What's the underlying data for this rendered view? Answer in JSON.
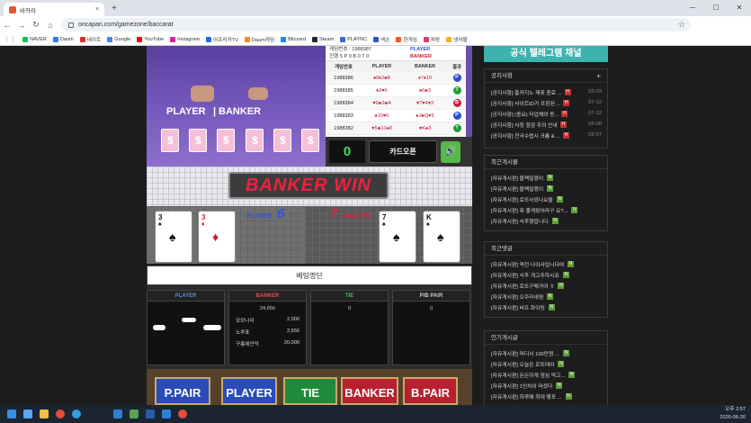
{
  "browser": {
    "tab_title": "바카라",
    "tab_close": "×",
    "new_tab": "+",
    "url": "oncapan.com/gamezone/baccarat",
    "win_min": "─",
    "win_max": "☐",
    "win_close": "✕"
  },
  "bookmarks": [
    {
      "label": "NAVER",
      "color": "#03c75a"
    },
    {
      "label": "Daum",
      "color": "#2b7de9"
    },
    {
      "label": "네이트",
      "color": "#e0302c"
    },
    {
      "label": "Google",
      "color": "#4285f4"
    },
    {
      "label": "YouTube",
      "color": "#ff0000"
    },
    {
      "label": "Instagram",
      "color": "#d6249f"
    },
    {
      "label": "아프리카TV",
      "color": "#1c6fe8"
    },
    {
      "label": "Daum게임",
      "color": "#f58a1f"
    },
    {
      "label": "Blizzard",
      "color": "#148eff"
    },
    {
      "label": "Steam",
      "color": "#1b2838"
    },
    {
      "label": "PLAYNC",
      "color": "#3a6ad1"
    },
    {
      "label": "넥슨",
      "color": "#2f59c4"
    },
    {
      "label": "한게임",
      "color": "#f25a29"
    },
    {
      "label": "피망",
      "color": "#e03a6c"
    },
    {
      "label": "넷마블",
      "color": "#f2b21a"
    }
  ],
  "game": {
    "felt_player": "PLAYER",
    "felt_banker": "BANKER",
    "history": {
      "round_label": "게임번호 : 1988387",
      "count_label": "진행 5  P 0  B 0  T 0",
      "player_head": "PLAYER",
      "banker_head": "BANKER",
      "columns": [
        "게임번호",
        "PLAYER",
        "BANKER",
        "결과"
      ],
      "rows": [
        {
          "no": "1988386",
          "p": "♠9♦2♣8",
          "b": "♦7♦10",
          "r": "P",
          "rc": "#2a4bd0"
        },
        {
          "no": "1988385",
          "p": "♠3♥6",
          "b": "♠6♣3",
          "r": "T",
          "rc": "#1f9c3a"
        },
        {
          "no": "1988384",
          "p": "♥9♣3♣A",
          "b": "♥7♥4♥3",
          "r": "B",
          "rc": "#d0203a"
        },
        {
          "no": "1988383",
          "p": "♠10♥6",
          "b": "♠J♣Q♥5",
          "r": "P",
          "rc": "#2a4bd0"
        },
        {
          "no": "1988382",
          "p": "♥5♣10♠8",
          "b": "♥K♠3",
          "r": "T",
          "rc": "#1f9c3a"
        }
      ]
    },
    "counter": "0",
    "card_open": "카드오픈",
    "sound_icon": "🔊",
    "result_text": "BANKER WIN",
    "player_side": {
      "label": "PLAYER",
      "score": "6"
    },
    "banker_side": {
      "label": "BANKER",
      "score": "7"
    },
    "cards": [
      {
        "rank": "3",
        "suit": "♠",
        "color": "#111"
      },
      {
        "rank": "3",
        "suit": "♦",
        "color": "#d0203a"
      },
      {
        "rank": "7",
        "suit": "♠",
        "color": "#111"
      },
      {
        "rank": "K",
        "suit": "♠",
        "color": "#111"
      }
    ]
  },
  "betting": {
    "title": "베팅명단",
    "cols": [
      {
        "label": "PLAYER",
        "color": "#4a8fe0"
      },
      {
        "label": "BANKER",
        "color": "#e05050"
      },
      {
        "label": "TIE",
        "color": "#3ec05a"
      },
      {
        "label": "P/B PAIR",
        "color": "#ccc"
      }
    ],
    "banker_total": "24,656",
    "tie_total": "0",
    "pair_total": "0",
    "banker_rows": [
      {
        "name": "모모나미",
        "amount": "2,000"
      },
      {
        "name": "노루표",
        "amount": "2,656"
      },
      {
        "name": "구름에언덕",
        "amount": "20,000"
      }
    ]
  },
  "chips": [
    {
      "label": "P.PAIR",
      "color": "#2a4bb8"
    },
    {
      "label": "PLAYER",
      "color": "#2a4bb8"
    },
    {
      "label": "TIE",
      "color": "#1f8a3a"
    },
    {
      "label": "BANKER",
      "color": "#b82030"
    },
    {
      "label": "B.PAIR",
      "color": "#b82030"
    }
  ],
  "sidebar": {
    "telegram": "공식 텔레그램 채널",
    "notice_head": "공지사항",
    "notice_plus": "+",
    "notices": [
      {
        "t": "[공지사항] 홈카지노 제휴 종료 ...",
        "d": "03-03"
      },
      {
        "t": "[공지사항] 사이트ID가 포함된 ...",
        "d": "07-12"
      },
      {
        "t": "[공지사항] (중요) 타업체와 동...",
        "d": "07-12"
      },
      {
        "t": "[공지사항] 사칭 점검 주의 안내",
        "d": "05-08"
      },
      {
        "t": "[공지사항] 전국수렵시 크롬 & ...",
        "d": "02-07"
      }
    ],
    "recent_head": "최근게시물",
    "recent": [
      "[자유게시판] 블랙밀했이",
      "[자유게시판] 블랙밀했이",
      "[자유게시판] 로또사셨나요들",
      "[자유게시판] 뭐 좋게왔어라구 요?...",
      "[자유게시판] 식후했읍니다"
    ],
    "comments_head": "최근댓글",
    "comments": [
      "[자유게시판] 역전 나이사입니다여",
      "[자유게시판] 식후 개고주하시죠",
      "[자유게시판] 로또구매가여 ㅎ",
      "[자유게시판] 오주라내염",
      "[자유게시판] 버프 화이팅"
    ],
    "popular_head": "인기게시글",
    "popular": [
      "[자유게시판] 머디서 100만원 ...",
      "[자유게시판] 오늘은 로또데이",
      "[자유게시판] 돈든하게 점심 먹고...",
      "[자유게시판] 1인치이 마셨다",
      "[자유게시판] 하루에 최대 몇포 ..."
    ],
    "new_badge": "N",
    "hot_badge": "H"
  },
  "taskbar": {
    "time": "오후 2:57",
    "date": "2026-06-20"
  }
}
